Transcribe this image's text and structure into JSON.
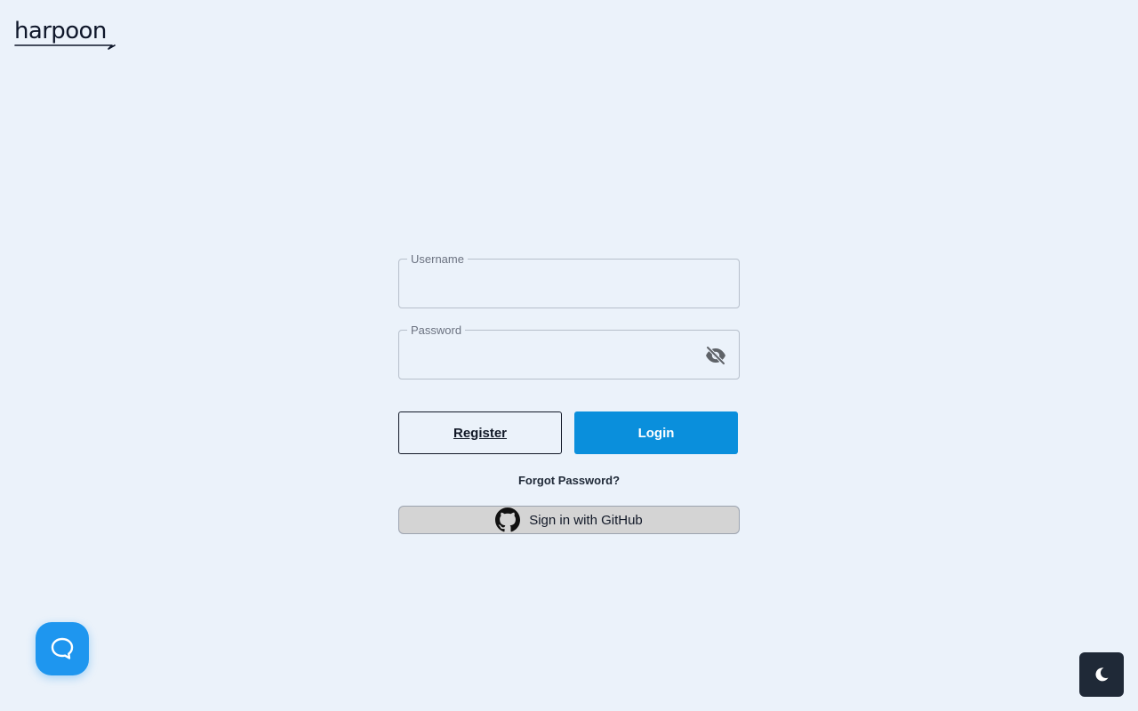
{
  "brand": {
    "logo_text": "harpoon",
    "text_color": "#0f172a"
  },
  "login_form": {
    "username": {
      "label": "Username",
      "value": ""
    },
    "password": {
      "label": "Password",
      "value": "",
      "visibility_icon": "eye-off-icon"
    },
    "register_label": "Register",
    "login_label": "Login",
    "forgot_password_label": "Forgot Password?",
    "github_label": "Sign in with GitHub",
    "github_icon": "github-icon"
  },
  "floating": {
    "support_icon": "chat-bubble-icon",
    "theme_icon": "moon-icon"
  },
  "colors": {
    "background": "#ebf2fa",
    "primary": "#0a8fdc",
    "support": "#1e96ef",
    "theme_button": "#1f2937",
    "github_button": "#d4d4d4"
  }
}
